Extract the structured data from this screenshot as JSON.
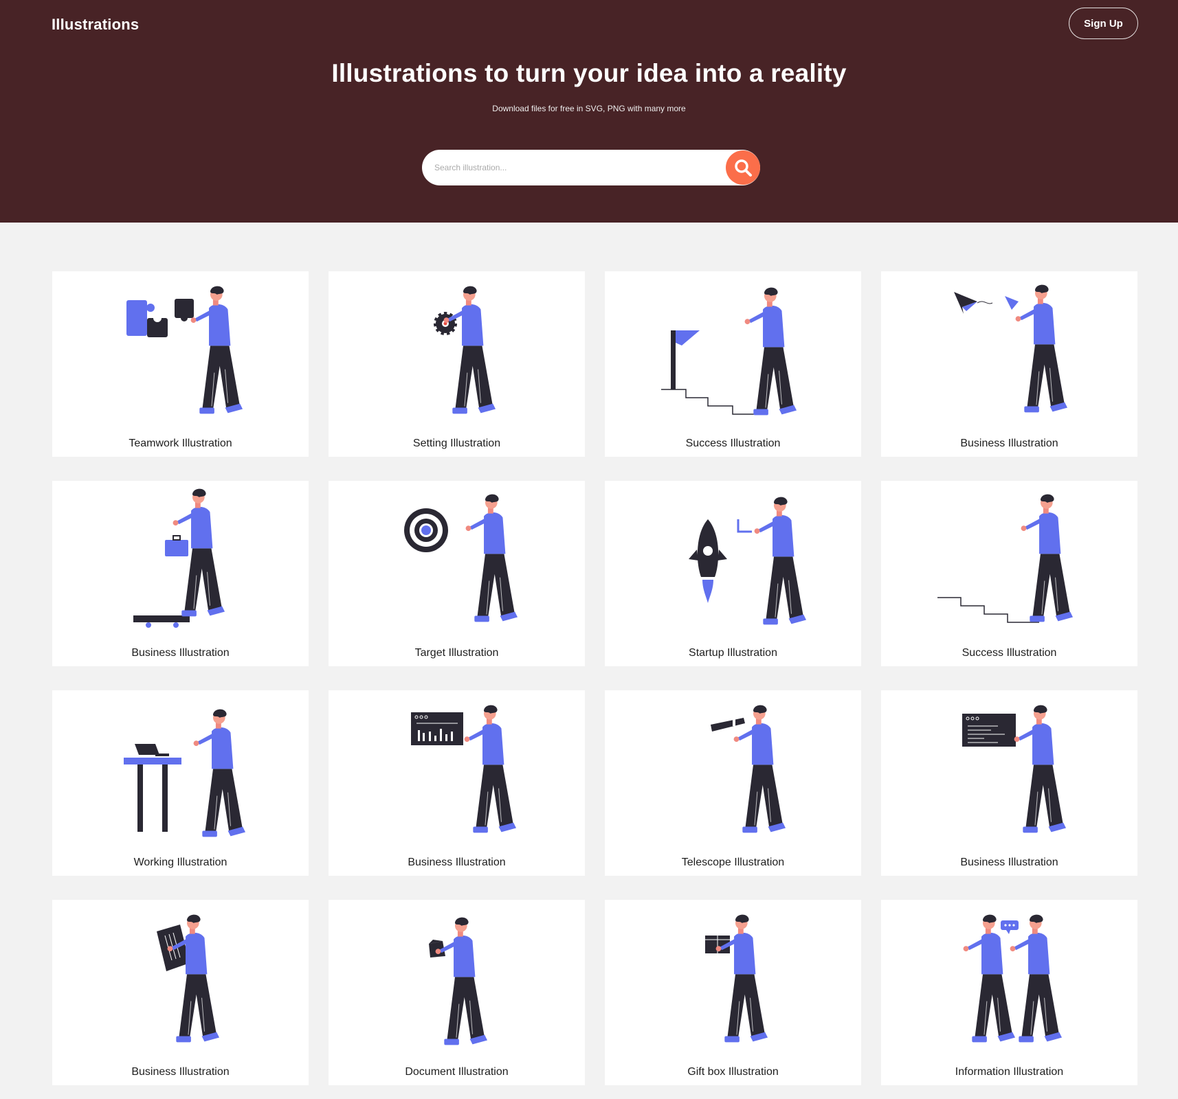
{
  "header": {
    "brand": "Illustrations",
    "signup_label": "Sign Up",
    "headline": "Illustrations to turn your idea into a reality",
    "subline": "Download  files for free in SVG, PNG with many more",
    "search_placeholder": "Search illustration..."
  },
  "colors": {
    "hero_bg": "#482326",
    "accent": "#fb6e4a",
    "figure_blue": "#6170ee",
    "figure_dark": "#2a2833"
  },
  "cards": [
    {
      "title": "Teamwork Illustration",
      "prop": "puzzle"
    },
    {
      "title": "Setting Illustration",
      "prop": "gear"
    },
    {
      "title": "Success Illustration",
      "prop": "flag-stairs"
    },
    {
      "title": "Business Illustration",
      "prop": "paper-plane"
    },
    {
      "title": "Business Illustration",
      "prop": "briefcase-skateboard"
    },
    {
      "title": "Target Illustration",
      "prop": "target"
    },
    {
      "title": "Startup Illustration",
      "prop": "rocket"
    },
    {
      "title": "Success Illustration",
      "prop": "stairs"
    },
    {
      "title": "Working Illustration",
      "prop": "desk-laptop"
    },
    {
      "title": "Business Illustration",
      "prop": "chart-board"
    },
    {
      "title": "Telescope Illustration",
      "prop": "telescope"
    },
    {
      "title": "Business Illustration",
      "prop": "text-board"
    },
    {
      "title": "Business Illustration",
      "prop": "ledger"
    },
    {
      "title": "Document Illustration",
      "prop": "document"
    },
    {
      "title": "Gift box Illustration",
      "prop": "gift-box"
    },
    {
      "title": "Information Illustration",
      "prop": "two-people-chat"
    }
  ]
}
